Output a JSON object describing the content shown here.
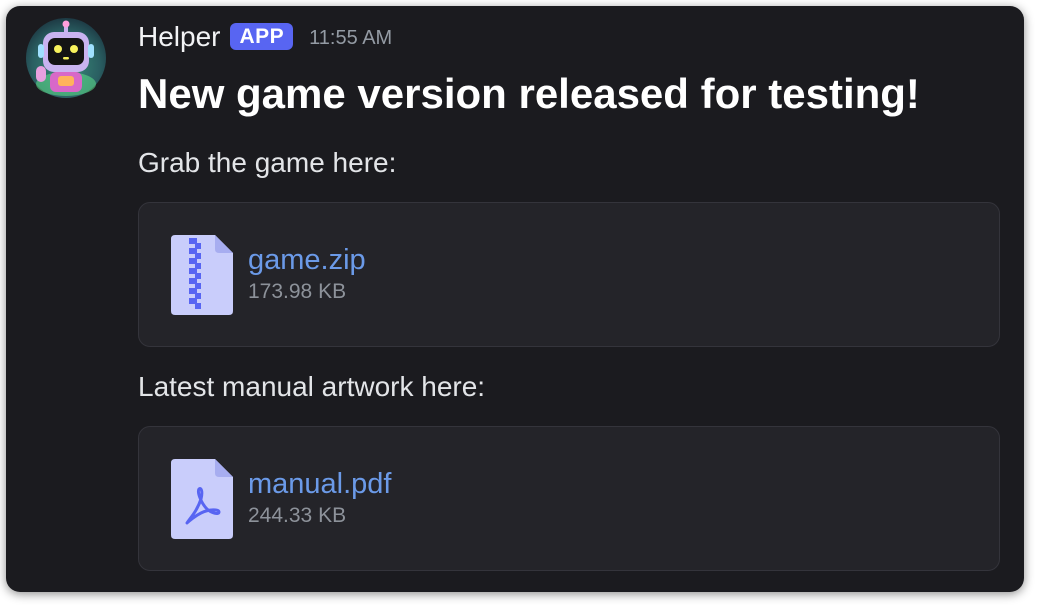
{
  "message": {
    "author": "Helper",
    "badge": "APP",
    "timestamp": "11:55 AM",
    "headline": "New game version released for testing!",
    "paragraphs": [
      "Grab the game here:",
      "Latest manual artwork here:"
    ],
    "attachments": [
      {
        "name": "game.zip",
        "size": "173.98 KB",
        "icon": "zip-file-icon"
      },
      {
        "name": "manual.pdf",
        "size": "244.33 KB",
        "icon": "pdf-file-icon"
      }
    ]
  },
  "colors": {
    "background": "#1b1b1f",
    "badge": "#5865f2",
    "link": "#6b9ae8",
    "attachment_bg": "#242429",
    "file_icon": "#c9cdfb"
  },
  "icons": {
    "avatar": "robot-avatar"
  }
}
